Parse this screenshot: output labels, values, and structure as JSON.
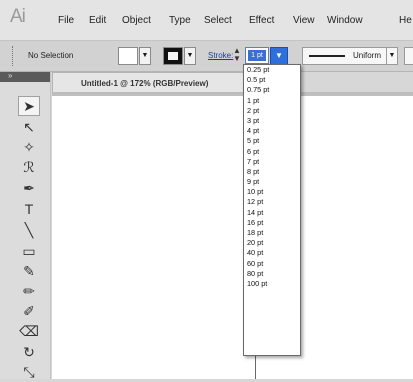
{
  "app": {
    "logo": "Ai"
  },
  "menu": [
    "File",
    "Edit",
    "Object",
    "Type",
    "Select",
    "Effect",
    "View",
    "Window",
    "He"
  ],
  "control": {
    "selection": "No Selection",
    "stroke_label": "Stroke:",
    "stroke_value": "1 pt",
    "profile": "Uniform",
    "fill_color": "#ffffff",
    "stroke_color": "#111111"
  },
  "tab": {
    "title": "Untitled-1 @ 172% (RGB/Preview)",
    "close": "×"
  },
  "tools": [
    {
      "name": "selection-tool",
      "glyph": "➤"
    },
    {
      "name": "direct-selection-tool",
      "glyph": "↖"
    },
    {
      "name": "magic-wand-tool",
      "glyph": "✧"
    },
    {
      "name": "lasso-tool",
      "glyph": "ℛ"
    },
    {
      "name": "pen-tool",
      "glyph": "✒"
    },
    {
      "name": "type-tool",
      "glyph": "T"
    },
    {
      "name": "line-tool",
      "glyph": "╲"
    },
    {
      "name": "rectangle-tool",
      "glyph": "▭"
    },
    {
      "name": "paintbrush-tool",
      "glyph": "✎"
    },
    {
      "name": "pencil-tool",
      "glyph": "✏"
    },
    {
      "name": "blob-brush-tool",
      "glyph": "✐"
    },
    {
      "name": "eraser-tool",
      "glyph": "⌫"
    },
    {
      "name": "rotate-tool",
      "glyph": "↻"
    },
    {
      "name": "scale-tool",
      "glyph": "⤡"
    }
  ],
  "stroke_options": [
    "0.25 pt",
    "0.5 pt",
    "0.75 pt",
    "1 pt",
    "2 pt",
    "3 pt",
    "4 pt",
    "5 pt",
    "6 pt",
    "7 pt",
    "8 pt",
    "9 pt",
    "10 pt",
    "12 pt",
    "14 pt",
    "16 pt",
    "18 pt",
    "20 pt",
    "40 pt",
    "60 pt",
    "80 pt",
    "100 pt"
  ]
}
